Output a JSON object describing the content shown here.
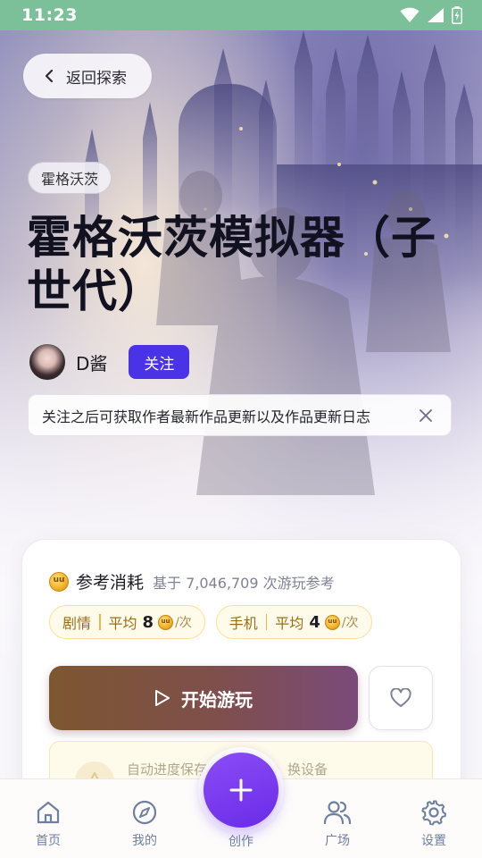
{
  "status_bar": {
    "time": "11:23"
  },
  "back_button": {
    "label": "返回探索"
  },
  "game": {
    "tag": "霍格沃茨",
    "title": "霍格沃茨模拟器（子世代）",
    "author": "D酱",
    "follow_label": "关注",
    "follow_tip": "关注之后可获取作者最新作品更新以及作品更新日志"
  },
  "cost": {
    "label": "参考消耗",
    "basis": "基于 7,046,709 次游玩参考",
    "chips": [
      {
        "name": "剧情",
        "avg_label": "平均",
        "value": "8",
        "unit": "/次"
      },
      {
        "name": "手机",
        "avg_label": "平均",
        "value": "4",
        "unit": "/次"
      }
    ]
  },
  "actions": {
    "play_label": "开始游玩"
  },
  "notice": {
    "text": "自动进度保存中，清缓存、换设备"
  },
  "nav": {
    "items": [
      {
        "label": "首页",
        "icon": "home-icon"
      },
      {
        "label": "我的",
        "icon": "compass-icon"
      },
      {
        "label": "创作",
        "icon": "plus-icon"
      },
      {
        "label": "广场",
        "icon": "users-icon"
      },
      {
        "label": "设置",
        "icon": "gear-icon"
      }
    ]
  },
  "colors": {
    "accent": "#4a33e6",
    "create": "#7a3cf0",
    "status_bar": "#7cc09a"
  }
}
